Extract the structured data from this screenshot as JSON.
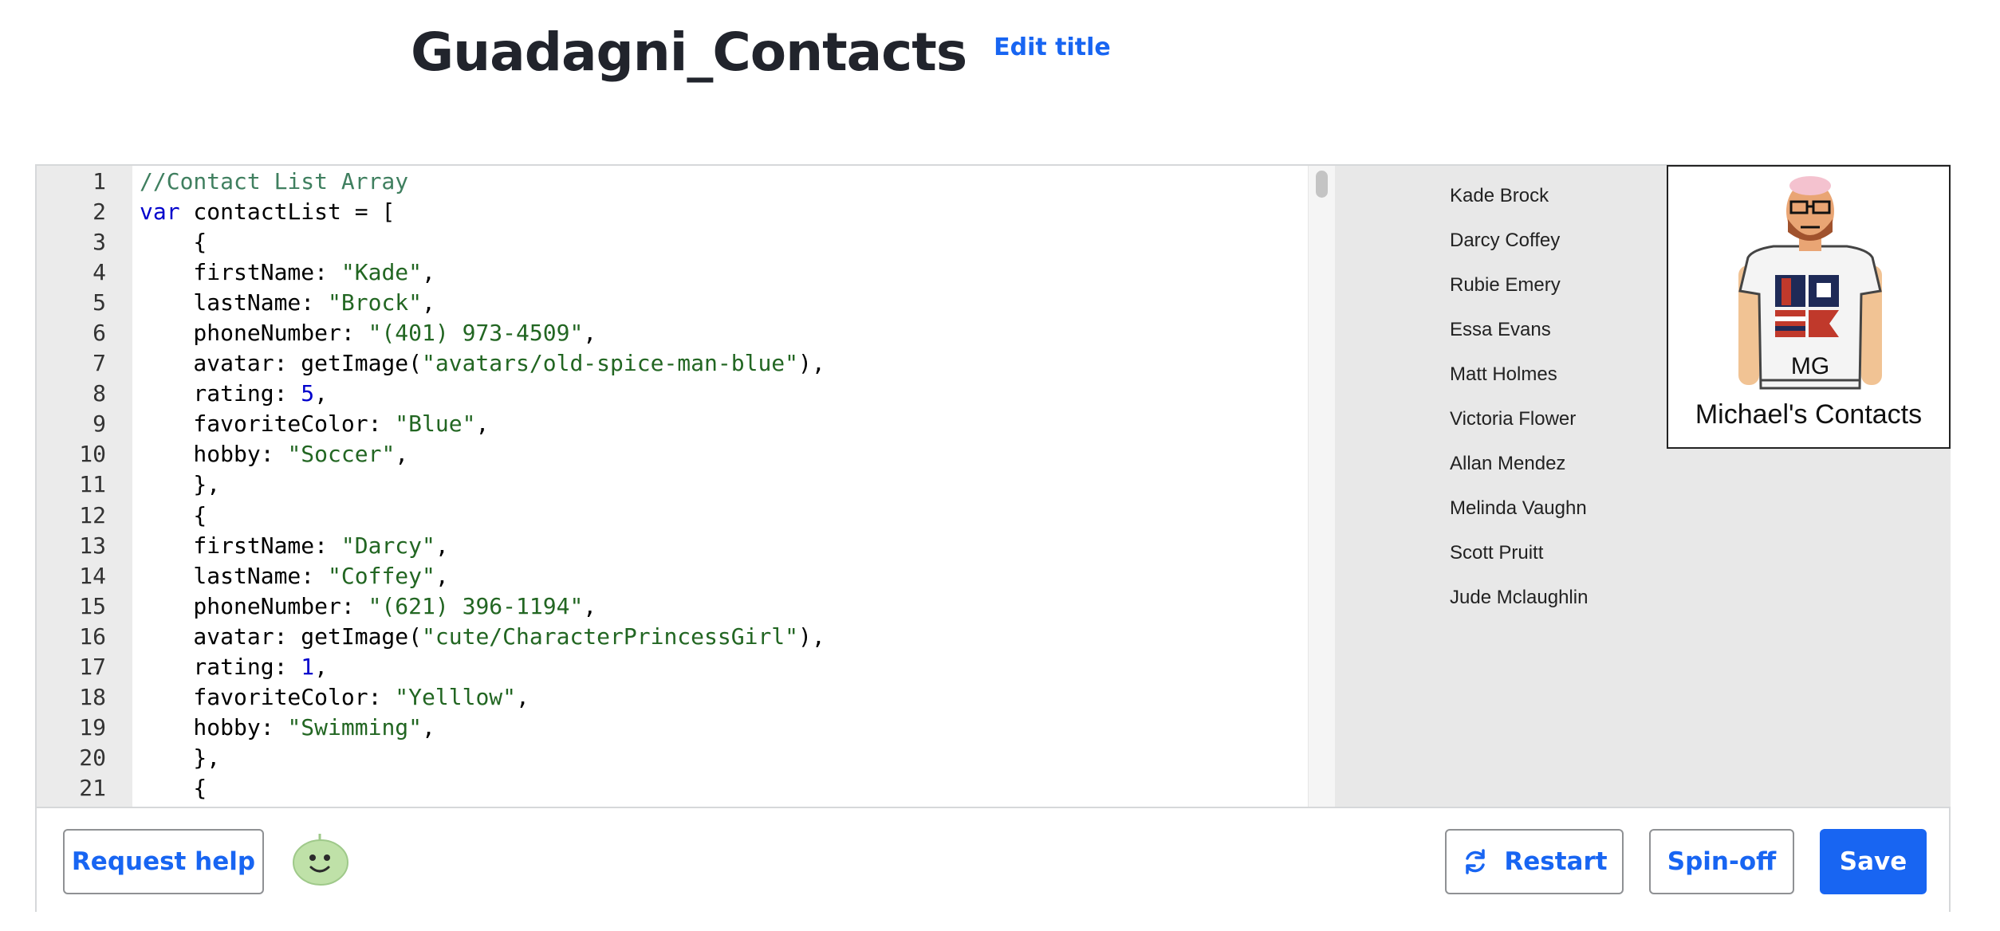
{
  "header": {
    "title": "Guadagni_Contacts",
    "edit_title_label": "Edit title"
  },
  "editor": {
    "lines": [
      {
        "n": "1",
        "fold": false,
        "tokens": [
          {
            "t": "//Contact List Array",
            "c": "comment"
          }
        ]
      },
      {
        "n": "2",
        "fold": true,
        "tokens": [
          {
            "t": "var",
            "c": "kw"
          },
          {
            "t": " contactList = [",
            "c": "plain"
          }
        ]
      },
      {
        "n": "3",
        "fold": true,
        "tokens": [
          {
            "t": "    {",
            "c": "plain"
          }
        ]
      },
      {
        "n": "4",
        "fold": false,
        "tokens": [
          {
            "t": "    firstName: ",
            "c": "plain"
          },
          {
            "t": "\"Kade\"",
            "c": "str"
          },
          {
            "t": ",",
            "c": "plain"
          }
        ]
      },
      {
        "n": "5",
        "fold": false,
        "tokens": [
          {
            "t": "    lastName: ",
            "c": "plain"
          },
          {
            "t": "\"Brock\"",
            "c": "str"
          },
          {
            "t": ",",
            "c": "plain"
          }
        ]
      },
      {
        "n": "6",
        "fold": false,
        "tokens": [
          {
            "t": "    phoneNumber: ",
            "c": "plain"
          },
          {
            "t": "\"(401) 973-4509\"",
            "c": "str"
          },
          {
            "t": ",",
            "c": "plain"
          }
        ]
      },
      {
        "n": "7",
        "fold": false,
        "tokens": [
          {
            "t": "    avatar: getImage(",
            "c": "plain"
          },
          {
            "t": "\"avatars/old-spice-man-blue\"",
            "c": "str"
          },
          {
            "t": "),",
            "c": "plain"
          }
        ]
      },
      {
        "n": "8",
        "fold": false,
        "tokens": [
          {
            "t": "    rating: ",
            "c": "plain"
          },
          {
            "t": "5",
            "c": "num"
          },
          {
            "t": ",",
            "c": "plain"
          }
        ]
      },
      {
        "n": "9",
        "fold": false,
        "tokens": [
          {
            "t": "    favoriteColor: ",
            "c": "plain"
          },
          {
            "t": "\"Blue\"",
            "c": "str"
          },
          {
            "t": ",",
            "c": "plain"
          }
        ]
      },
      {
        "n": "10",
        "fold": false,
        "tokens": [
          {
            "t": "    hobby: ",
            "c": "plain"
          },
          {
            "t": "\"Soccer\"",
            "c": "str"
          },
          {
            "t": ",",
            "c": "plain"
          }
        ]
      },
      {
        "n": "11",
        "fold": false,
        "tokens": [
          {
            "t": "    },",
            "c": "plain"
          }
        ]
      },
      {
        "n": "12",
        "fold": true,
        "tokens": [
          {
            "t": "    {",
            "c": "plain"
          }
        ]
      },
      {
        "n": "13",
        "fold": false,
        "tokens": [
          {
            "t": "    firstName: ",
            "c": "plain"
          },
          {
            "t": "\"Darcy\"",
            "c": "str"
          },
          {
            "t": ",",
            "c": "plain"
          }
        ]
      },
      {
        "n": "14",
        "fold": false,
        "tokens": [
          {
            "t": "    lastName: ",
            "c": "plain"
          },
          {
            "t": "\"Coffey\"",
            "c": "str"
          },
          {
            "t": ",",
            "c": "plain"
          }
        ]
      },
      {
        "n": "15",
        "fold": false,
        "tokens": [
          {
            "t": "    phoneNumber: ",
            "c": "plain"
          },
          {
            "t": "\"(621) 396-1194\"",
            "c": "str"
          },
          {
            "t": ",",
            "c": "plain"
          }
        ]
      },
      {
        "n": "16",
        "fold": false,
        "tokens": [
          {
            "t": "    avatar: getImage(",
            "c": "plain"
          },
          {
            "t": "\"cute/CharacterPrincessGirl\"",
            "c": "str"
          },
          {
            "t": "),",
            "c": "plain"
          }
        ]
      },
      {
        "n": "17",
        "fold": false,
        "tokens": [
          {
            "t": "    rating: ",
            "c": "plain"
          },
          {
            "t": "1",
            "c": "num"
          },
          {
            "t": ",",
            "c": "plain"
          }
        ]
      },
      {
        "n": "18",
        "fold": false,
        "tokens": [
          {
            "t": "    favoriteColor: ",
            "c": "plain"
          },
          {
            "t": "\"Yelllow\"",
            "c": "str"
          },
          {
            "t": ",",
            "c": "plain"
          }
        ]
      },
      {
        "n": "19",
        "fold": false,
        "tokens": [
          {
            "t": "    hobby: ",
            "c": "plain"
          },
          {
            "t": "\"Swimming\"",
            "c": "str"
          },
          {
            "t": ",",
            "c": "plain"
          }
        ]
      },
      {
        "n": "20",
        "fold": false,
        "tokens": [
          {
            "t": "    },",
            "c": "plain"
          }
        ]
      },
      {
        "n": "21",
        "fold": true,
        "tokens": [
          {
            "t": "    {",
            "c": "plain"
          }
        ]
      }
    ]
  },
  "output": {
    "contacts": [
      "Kade Brock",
      "Darcy Coffey",
      "Rubie Emery",
      "Essa Evans",
      "Matt Holmes",
      "Victoria Flower",
      "Allan Mendez",
      "Melinda Vaughn",
      "Scott Pruitt",
      "Jude Mclaughlin"
    ],
    "card": {
      "shirt_text": "MG",
      "caption": "Michael's Contacts"
    }
  },
  "toolbar": {
    "help_label": "Request help",
    "restart_label": "Restart",
    "spinoff_label": "Spin-off",
    "save_label": "Save"
  },
  "colors": {
    "accent": "#1865f2",
    "comment": "#3f7f5f",
    "keyword": "#0000cc",
    "string": "#226622",
    "number": "#0000cc"
  },
  "icons": {
    "restart": "refresh-icon",
    "help_blob": "winston-blob-icon",
    "card_avatar": "avatar-icon"
  }
}
